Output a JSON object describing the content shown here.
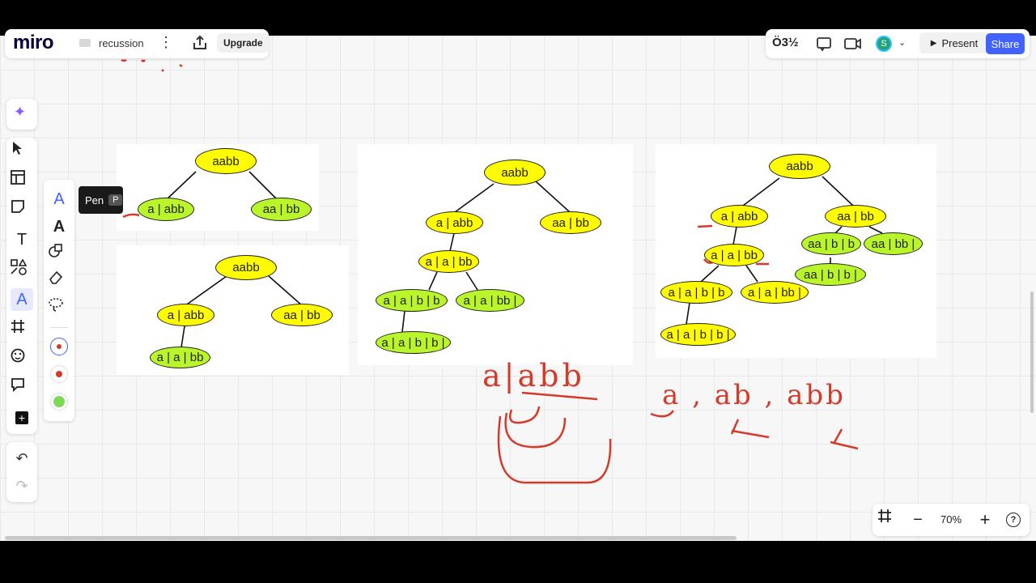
{
  "app": {
    "logo": "miro",
    "board_name": "recussion",
    "upgrade_label": "Upgrade",
    "reactions_label": "Ö3½",
    "avatar_initial": "S",
    "present_label": "Present",
    "share_label": "Share"
  },
  "tooltip": {
    "label": "Pen",
    "shortcut": "P"
  },
  "zoom": {
    "level": "70%"
  },
  "colors": {
    "accent": "#4262ff",
    "node_yellow": "#fffb00",
    "node_green": "#b9f52a",
    "ink_red": "#d43a2a"
  },
  "frames": {
    "f1": {
      "root": "aabb",
      "left": "a | abb",
      "right": "aa | bb"
    },
    "f2": {
      "root": "aabb",
      "left": "a | abb",
      "right": "aa | bb",
      "ll": "a | a | bb"
    },
    "f3": {
      "root": "aabb",
      "left": "a | abb",
      "right": "aa | bb",
      "ll": "a | a | bb",
      "lll": "a | a | b | b",
      "llr": "a | a | bb |",
      "llll": "a | a | b | b |"
    },
    "f4": {
      "root": "aabb",
      "left": "a | abb",
      "right": "aa | bb",
      "rl": "aa | b | b",
      "rr": "aa | bb |",
      "rll": "aa | b | b |",
      "ll": "a | a | bb",
      "lll": "a | a | b | b",
      "llr": "a | a | bb |",
      "llll": "a | a | b | b |"
    }
  },
  "handwriting": {
    "split_text": "a|abb",
    "prefixes": "a , ab , abb"
  }
}
